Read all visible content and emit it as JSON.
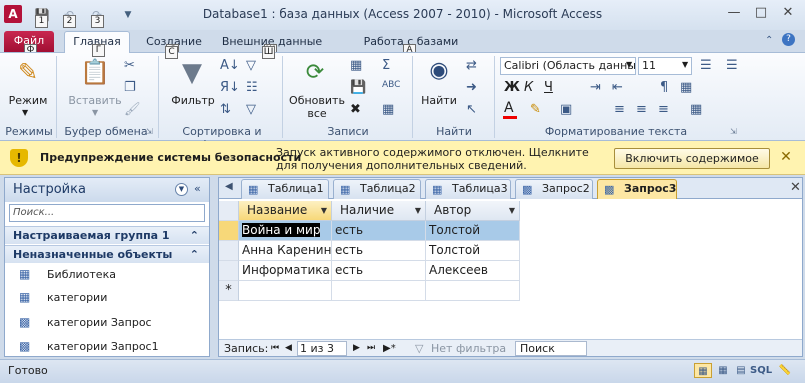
{
  "window": {
    "title": "Database1 : база данных (Access 2007 - 2010)  -  Microsoft Access",
    "app_icon": "A",
    "keytip_qat1": "1",
    "keytip_qat2": "2",
    "keytip_qat3": "3",
    "keytip_file": "Ф",
    "keytip_home": "Г",
    "keytip_create": "С",
    "keytip_external": "Ш",
    "keytip_dbtools": "А"
  },
  "ribbon": {
    "tabs": [
      "Файл",
      "Главная",
      "Создание",
      "Внешние данные",
      "Работа с базами данных"
    ],
    "views": {
      "label": "Режим",
      "group": "Режимы"
    },
    "clipboard": {
      "label": "Вставить",
      "group": "Буфер обмена"
    },
    "sort": {
      "label": "Фильтр",
      "group": "Сортировка и фильтр"
    },
    "records": {
      "label": "Обновить\nвсе",
      "label1": "Обновить",
      "label2": "все",
      "group": "Записи"
    },
    "find": {
      "label": "Найти",
      "group": "Найти"
    },
    "format": {
      "font": "Calibri (Область данны",
      "size": "11",
      "group": "Форматирование текста"
    }
  },
  "security_bar": {
    "title": "Предупреждение системы безопасности",
    "message": "Запуск активного содержимого отключен. Щелкните для получения дополнительных сведений.",
    "button": "Включить содержимое"
  },
  "nav_pane": {
    "title": "Настройка",
    "search_placeholder": "Поиск...",
    "groups": [
      {
        "label": "Настраиваемая группа 1"
      },
      {
        "label": "Неназначенные объекты"
      }
    ],
    "items": [
      {
        "label": "Библиотека",
        "icon": "table-icon"
      },
      {
        "label": "категории",
        "icon": "table-icon"
      },
      {
        "label": "категории Запрос",
        "icon": "query-icon"
      },
      {
        "label": "категории Запрос1",
        "icon": "query-icon"
      }
    ]
  },
  "doc_tabs": [
    {
      "label": "Таблица1",
      "icon": "table-icon"
    },
    {
      "label": "Таблица2",
      "icon": "table-icon"
    },
    {
      "label": "Таблица3",
      "icon": "table-icon"
    },
    {
      "label": "Запрос2",
      "icon": "query-icon"
    },
    {
      "label": "Запрос3",
      "icon": "query-icon",
      "active": true
    }
  ],
  "grid": {
    "columns": [
      "Название",
      "Наличие",
      "Автор"
    ],
    "rows": [
      [
        "Война и мир",
        "есть",
        "Толстой"
      ],
      [
        "Анна Каренина",
        "есть",
        "Толстой"
      ],
      [
        "Информатика",
        "есть",
        "Алексеев"
      ]
    ],
    "new_row_marker": "*"
  },
  "record_nav": {
    "label": "Запись:",
    "counter": "1 из 3",
    "filter": "Нет фильтра",
    "search": "Поиск"
  },
  "status_bar": {
    "text": "Готово",
    "sql": "SQL"
  }
}
